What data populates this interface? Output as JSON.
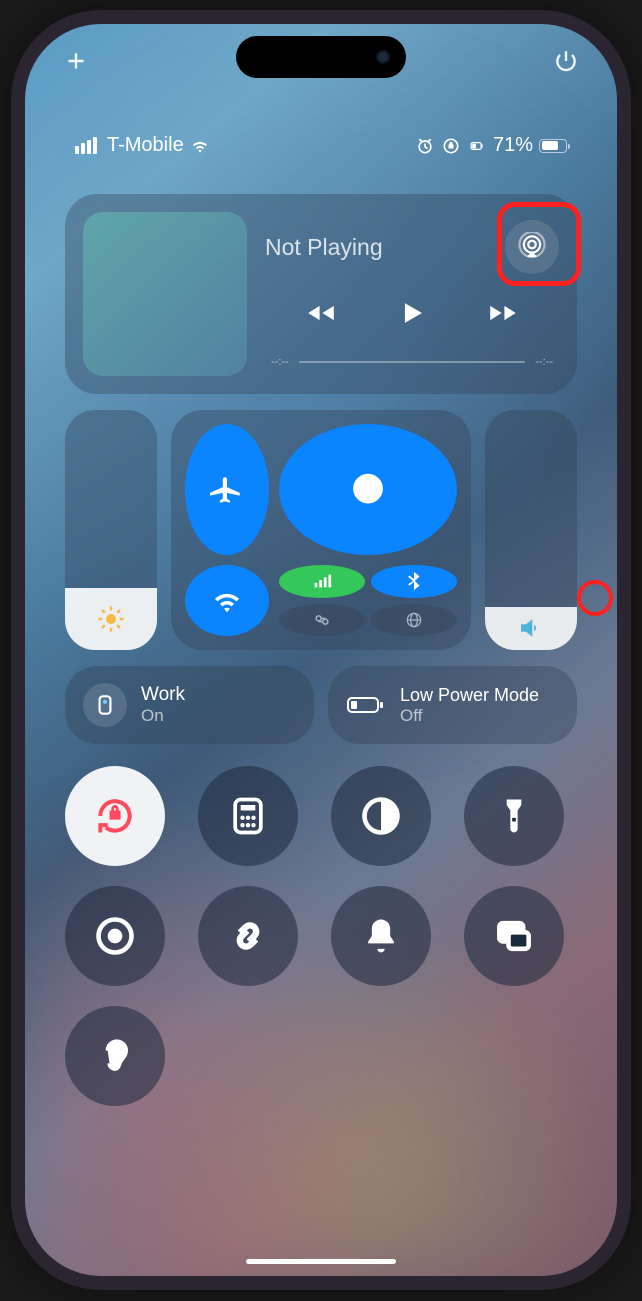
{
  "status": {
    "carrier": "T-Mobile",
    "battery_pct": "71%"
  },
  "media": {
    "title": "Not Playing",
    "elapsed": "--:--",
    "remaining": "--:--"
  },
  "focus": {
    "name": "Work",
    "state": "On"
  },
  "low_power": {
    "title": "Low Power Mode",
    "state": "Off"
  },
  "icons": {
    "add": "add-icon",
    "power": "power-icon",
    "airplay": "airplay-audio-icon",
    "airplane": "airplane-icon",
    "airdrop": "airdrop-icon",
    "wifi": "wifi-icon",
    "cellular": "cellular-icon",
    "bluetooth": "bluetooth-icon",
    "hotspot": "hotspot-icon",
    "vpn": "vpn-icon",
    "sun": "brightness-icon",
    "speaker": "volume-icon",
    "focus_badge": "id-card-icon",
    "battery": "battery-low-icon",
    "lock": "rotation-lock-icon",
    "calc": "calculator-icon",
    "darkmode": "dark-mode-icon",
    "flashlight": "flashlight-icon",
    "record": "screen-record-icon",
    "shazam": "shazam-icon",
    "silent": "silent-bell-icon",
    "mirror": "screen-mirror-icon",
    "ear": "hearing-icon",
    "heart": "favorites-page-icon",
    "music": "music-page-icon",
    "home": "home-page-icon",
    "antenna": "connectivity-page-icon"
  },
  "sliders": {
    "brightness_pct": 26,
    "volume_pct": 18
  }
}
